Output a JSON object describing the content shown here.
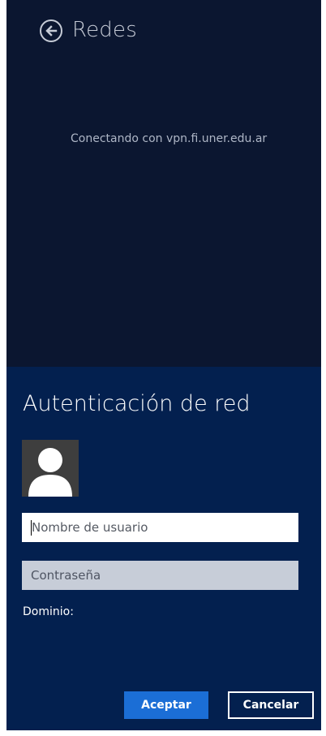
{
  "header": {
    "back_icon": "back-arrow-icon",
    "title": "Redes"
  },
  "status": {
    "connecting_text": "Conectando con vpn.fi.uner.edu.ar"
  },
  "auth": {
    "title": "Autenticación de red",
    "avatar_icon": "user-silhouette-icon",
    "username": {
      "value": "",
      "placeholder": "Nombre de usuario"
    },
    "password": {
      "value": "",
      "placeholder": "Contraseña"
    },
    "domain_label": "Dominio:",
    "accept_label": "Aceptar",
    "cancel_label": "Cancelar"
  },
  "colors": {
    "top_background": "#0b1630",
    "auth_background": "#03204f",
    "accent": "#1b6ed6",
    "password_field": "#c7cdd8"
  }
}
